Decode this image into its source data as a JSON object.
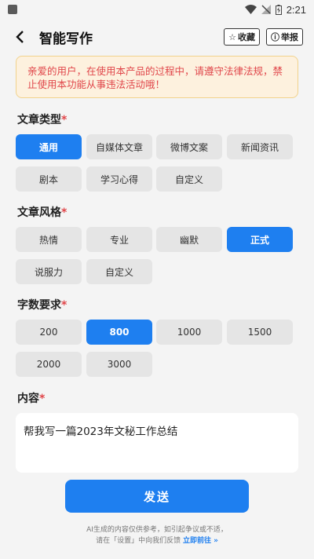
{
  "statusbar": {
    "time": "2:21"
  },
  "header": {
    "title": "智能写作",
    "favorite_label": "收藏",
    "report_label": "举报"
  },
  "notice": {
    "text": "亲爱的用户，在使用本产品的过程中，请遵守法律法规，禁止使用本功能从事违法活动哦！"
  },
  "article_type": {
    "label": "文章类型",
    "options": [
      "通用",
      "自媒体文章",
      "微博文案",
      "新闻资讯",
      "剧本",
      "学习心得",
      "自定义"
    ],
    "selected": "通用"
  },
  "article_style": {
    "label": "文章风格",
    "options": [
      "热情",
      "专业",
      "幽默",
      "正式",
      "说服力",
      "自定义"
    ],
    "selected": "正式"
  },
  "word_count": {
    "label": "字数要求",
    "options": [
      "200",
      "800",
      "1000",
      "1500",
      "2000",
      "3000"
    ],
    "selected": "800"
  },
  "content": {
    "label": "内容",
    "value": "帮我写一篇2023年文秘工作总结"
  },
  "send_label": "发送",
  "footer": {
    "line1": "AI生成的内容仅供参考，如引起争议或不适，",
    "line2_prefix": "请在「设置」中向我们反馈",
    "link": "立即前往 »"
  },
  "colors": {
    "accent": "#1e7ff0",
    "warning_text": "#e0464a",
    "notice_bg": "#fdf1de"
  }
}
